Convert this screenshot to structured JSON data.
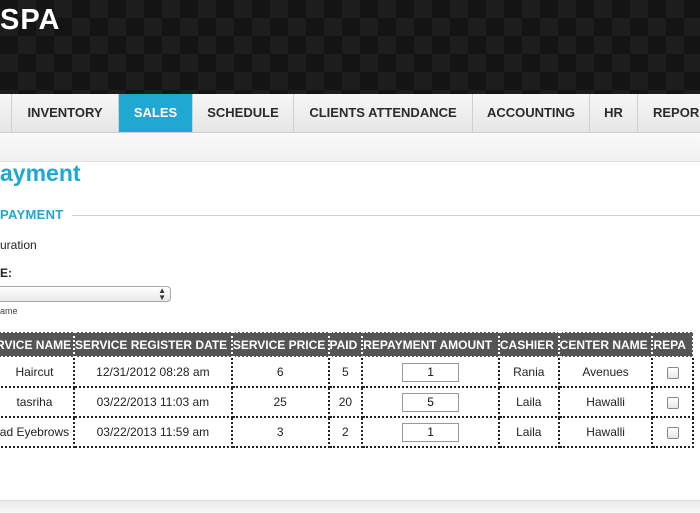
{
  "app": {
    "logo": "SPA"
  },
  "nav": {
    "items": [
      {
        "label": "INVENTORY"
      },
      {
        "label": "SALES"
      },
      {
        "label": "SCHEDULE"
      },
      {
        "label": "CLIENTS ATTENDANCE"
      },
      {
        "label": "ACCOUNTING"
      },
      {
        "label": "HR"
      },
      {
        "label": "REPOR"
      }
    ],
    "active": "SALES",
    "active_color": "#1ea8d2"
  },
  "page": {
    "title": "ayment",
    "section_title": "PAYMENT",
    "duration_label": "uration",
    "field_label": "E:",
    "select_value": "",
    "hint": "ame"
  },
  "table": {
    "headers": [
      "RVICE NAME",
      "SERVICE REGISTER DATE",
      "SERVICE PRICE",
      "PAID",
      "REPAYMENT AMOUNT",
      "CASHIER",
      "CENTER NAME",
      "REPA"
    ],
    "rows": [
      {
        "service": "Haircut",
        "date": "12/31/2012 08:28 am",
        "price": "6",
        "paid": "5",
        "repayment": "1",
        "cashier": "Rania",
        "center": "Avenues"
      },
      {
        "service": "tasriha",
        "date": "03/22/2013 11:03 am",
        "price": "25",
        "paid": "20",
        "repayment": "5",
        "cashier": "Laila",
        "center": "Hawalli"
      },
      {
        "service": "ad Eyebrows",
        "date": "03/22/2013 11:59 am",
        "price": "3",
        "paid": "2",
        "repayment": "1",
        "cashier": "Laila",
        "center": "Hawalli"
      }
    ]
  }
}
